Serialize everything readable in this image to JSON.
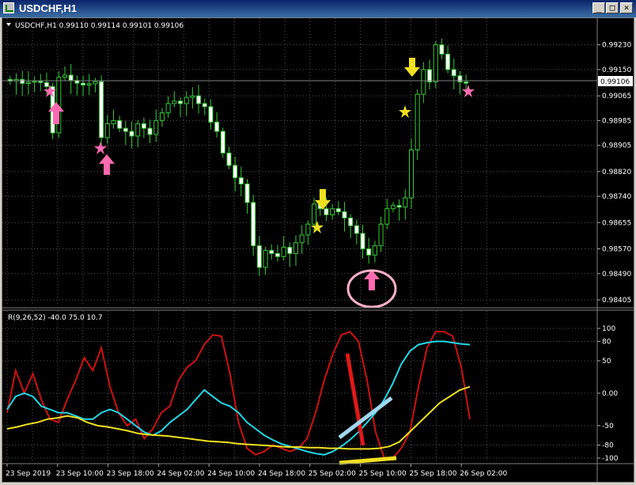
{
  "window": {
    "title": "USDCHF,H1",
    "buttons": {
      "minimize": "_",
      "maximize": "□",
      "close": "×"
    }
  },
  "chart_data": [
    {
      "type": "candlestick",
      "title": "USDCHF,H1  0.99110 0.99114 0.99101 0.99106",
      "symbol": "USDCHF",
      "timeframe": "H1",
      "ohlc": [
        0.9911,
        0.99114,
        0.99101,
        0.99106
      ],
      "price_axis": [
        "0.99230",
        "0.99150",
        "0.99065",
        "0.98985",
        "0.98905",
        "0.98820",
        "0.98740",
        "0.98655",
        "0.98570",
        "0.98490",
        "0.98405"
      ],
      "current_price": "0.99106",
      "ylim": [
        0.98405,
        0.99265
      ],
      "series_close": [
        0.99113,
        0.99118,
        0.99105,
        0.99109,
        0.99112,
        0.99108,
        0.99095,
        0.98945,
        0.99125,
        0.99132,
        0.99115,
        0.99106,
        0.991,
        0.99104,
        0.99111,
        0.9893,
        0.98975,
        0.98985,
        0.9896,
        0.9895,
        0.98935,
        0.98975,
        0.9896,
        0.9894,
        0.98985,
        0.9901,
        0.9904,
        0.99048,
        0.9904,
        0.9906,
        0.99065,
        0.9904,
        0.9903,
        0.9898,
        0.9895,
        0.9888,
        0.9884,
        0.988,
        0.9878,
        0.9872,
        0.9858,
        0.9851,
        0.98565,
        0.98555,
        0.98545,
        0.98575,
        0.98555,
        0.9859,
        0.98615,
        0.9865,
        0.98715,
        0.987,
        0.9868,
        0.987,
        0.9869,
        0.9867,
        0.98645,
        0.9862,
        0.9857,
        0.9855,
        0.9858,
        0.9865,
        0.987,
        0.9871,
        0.98705,
        0.98735,
        0.9889,
        0.9907,
        0.9915,
        0.9911,
        0.9923,
        0.992,
        0.9915,
        0.9913,
        0.9911,
        0.99106
      ]
    },
    {
      "type": "line",
      "title": "R(9,26,52) -40.0 75.0 10.7",
      "y_axis": [
        "100",
        "80",
        "50",
        "0.00",
        "-50",
        "-80",
        "-100"
      ],
      "ylim": [
        -105,
        105
      ],
      "series": [
        {
          "color": "#d01010",
          "values": [
            -30,
            35,
            0,
            30,
            -10,
            -40,
            -45,
            -10,
            20,
            55,
            35,
            70,
            10,
            -30,
            -50,
            -40,
            -70,
            -55,
            -30,
            -20,
            20,
            40,
            50,
            75,
            90,
            88,
            30,
            -45,
            -85,
            -95,
            -90,
            -80,
            -85,
            -90,
            -85,
            -70,
            -30,
            20,
            60,
            90,
            95,
            80,
            20,
            -60,
            -100,
            -100,
            -85,
            -60,
            10,
            70,
            95,
            95,
            88,
            40,
            -40
          ]
        },
        {
          "color": "#20d8e8",
          "values": [
            -25,
            -5,
            0,
            -5,
            -20,
            -25,
            -30,
            -30,
            -35,
            -40,
            -40,
            -30,
            -25,
            -30,
            -40,
            -50,
            -60,
            -65,
            -58,
            -45,
            -35,
            -25,
            -10,
            5,
            -5,
            -15,
            -20,
            -30,
            -45,
            -55,
            -65,
            -72,
            -78,
            -82,
            -86,
            -90,
            -93,
            -95,
            -90,
            -82,
            -72,
            -60,
            -45,
            -30,
            -10,
            15,
            45,
            65,
            75,
            78,
            80,
            80,
            78,
            76,
            75
          ]
        },
        {
          "color": "#f0e020",
          "values": [
            -55,
            -52,
            -48,
            -45,
            -40,
            -38,
            -35,
            -38,
            -45,
            -50,
            -52,
            -55,
            -58,
            -62,
            -64,
            -65,
            -66,
            -68,
            -70,
            -72,
            -74,
            -75,
            -76,
            -78,
            -79,
            -80,
            -81,
            -82,
            -83,
            -83,
            -84,
            -84,
            -85,
            -85,
            -86,
            -86,
            -86,
            -85,
            -82,
            -75,
            -60,
            -45,
            -30,
            -15,
            -5,
            5,
            10
          ]
        }
      ]
    }
  ],
  "time_axis": [
    "23 Sep 2019",
    "23 Sep 10:00",
    "23 Sep 18:00",
    "24 Sep 02:00",
    "24 Sep 10:00",
    "24 Sep 18:00",
    "25 Sep 02:00",
    "25 Sep 10:00",
    "25 Sep 18:00",
    "26 Sep 02:00"
  ]
}
